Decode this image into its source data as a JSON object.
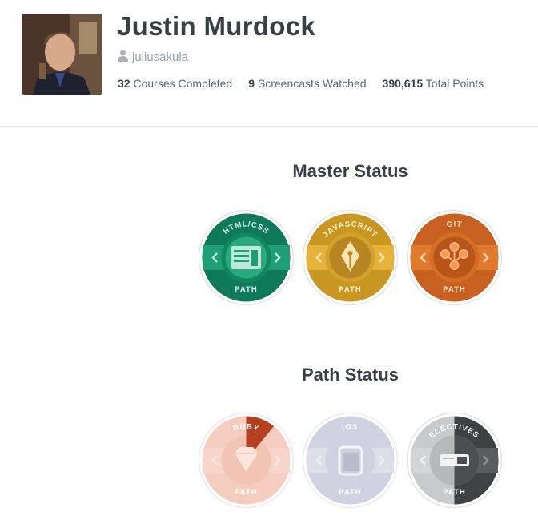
{
  "profile": {
    "name": "Justin Murdock",
    "username": "juliusakula",
    "stats": [
      {
        "value": "32",
        "label": "Courses Completed"
      },
      {
        "value": "9",
        "label": "Screencasts Watched"
      },
      {
        "value": "390,615",
        "label": "Total Points"
      }
    ]
  },
  "master_status": {
    "title": "Master Status",
    "badges": [
      {
        "top": "HTML/CSS",
        "bottom": "PATH",
        "icon": "html-css-icon",
        "color": "#1b9a73"
      },
      {
        "top": "JAVASCRIPT",
        "bottom": "PATH",
        "icon": "pen-nib-icon",
        "color": "#e6b33a"
      },
      {
        "top": "GIT",
        "bottom": "PATH",
        "icon": "git-branch-icon",
        "color": "#e07a2c"
      }
    ]
  },
  "path_status": {
    "title": "Path Status",
    "badges": [
      {
        "top": "RUBY",
        "bottom": "PATH",
        "icon": "ruby-gem-icon",
        "color": "#f2c2b0",
        "progress_fraction": 0.1
      },
      {
        "top": "IOS",
        "bottom": "PATH",
        "icon": "ios-device-icon",
        "color": "#d6d8e6",
        "progress_fraction": 0
      },
      {
        "top": "ELECTIVES",
        "bottom": "PATH",
        "icon": "electives-icon",
        "color": "#b8babc",
        "progress_fraction": 0.5
      }
    ]
  }
}
